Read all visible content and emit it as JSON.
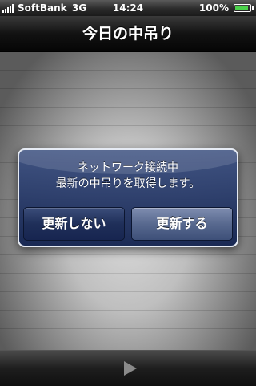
{
  "status_bar": {
    "carrier": "SoftBank",
    "network": "3G",
    "time": "14:24",
    "battery_percent": "100%",
    "battery_level": 1.0,
    "signal_bars": 5
  },
  "nav": {
    "title": "今日の中吊り"
  },
  "alert": {
    "message_line1": "ネットワーク接続中",
    "message_line2": "最新の中吊りを取得します。",
    "cancel_label": "更新しない",
    "confirm_label": "更新する"
  },
  "toolbar": {
    "play_icon": "play-icon"
  },
  "colors": {
    "alert_top": "#3e5282",
    "alert_bottom": "#162652",
    "battery_fill": "#4cd24c"
  }
}
